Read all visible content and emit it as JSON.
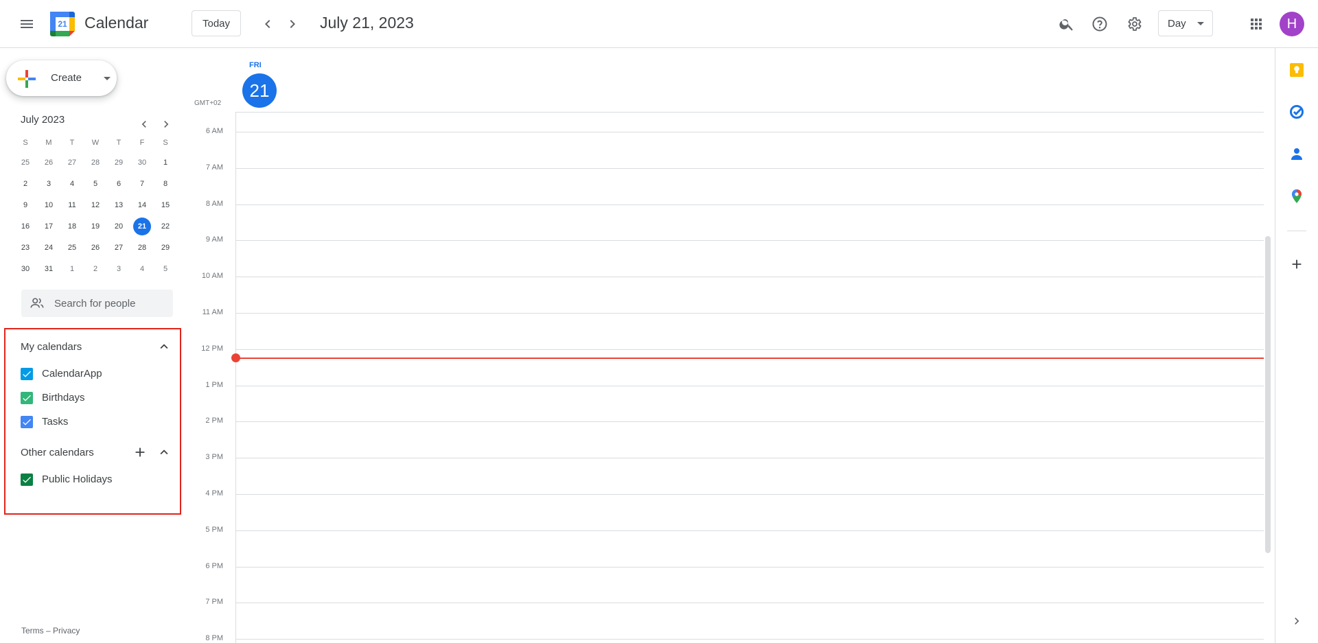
{
  "header": {
    "app_title": "Calendar",
    "logo_day": "21",
    "today_label": "Today",
    "date_title": "July 21, 2023",
    "view_label": "Day",
    "avatar_initial": "H",
    "icons": [
      "menu-icon",
      "chevron-left-icon",
      "chevron-right-icon",
      "search-icon",
      "help-icon",
      "settings-icon",
      "apps-icon"
    ]
  },
  "sidebar": {
    "create_label": "Create",
    "mini_calendar": {
      "month_title": "July 2023",
      "weekdays": [
        "S",
        "M",
        "T",
        "W",
        "T",
        "F",
        "S"
      ],
      "weeks": [
        [
          "25",
          "26",
          "27",
          "28",
          "29",
          "30",
          "1"
        ],
        [
          "2",
          "3",
          "4",
          "5",
          "6",
          "7",
          "8"
        ],
        [
          "9",
          "10",
          "11",
          "12",
          "13",
          "14",
          "15"
        ],
        [
          "16",
          "17",
          "18",
          "19",
          "20",
          "21",
          "22"
        ],
        [
          "23",
          "24",
          "25",
          "26",
          "27",
          "28",
          "29"
        ],
        [
          "30",
          "31",
          "1",
          "2",
          "3",
          "4",
          "5"
        ]
      ],
      "selected": "21"
    },
    "people_search_placeholder": "Search for people",
    "my_calendars": {
      "title": "My calendars",
      "items": [
        {
          "label": "CalendarApp",
          "color": "#039be5"
        },
        {
          "label": "Birthdays",
          "color": "#33b679"
        },
        {
          "label": "Tasks",
          "color": "#4285f4"
        }
      ]
    },
    "other_calendars": {
      "title": "Other calendars",
      "items": [
        {
          "label": "Public Holidays",
          "color": "#0b8043"
        }
      ]
    },
    "footer": {
      "terms": "Terms",
      "separator": "–",
      "privacy": "Privacy"
    }
  },
  "day_view": {
    "weekday": "FRI",
    "day_number": "21",
    "timezone": "GMT+02",
    "hours": [
      "6 AM",
      "7 AM",
      "8 AM",
      "9 AM",
      "10 AM",
      "11 AM",
      "12 PM",
      "1 PM",
      "2 PM",
      "3 PM",
      "4 PM",
      "5 PM",
      "6 PM",
      "7 PM",
      "8 PM"
    ],
    "now_indicator_color": "#ea4335"
  },
  "right_rail": {
    "icons": [
      "keep-icon",
      "tasks-icon",
      "contacts-icon",
      "maps-icon",
      "add-icon",
      "chevron-right-icon"
    ]
  },
  "colors": {
    "accent": "#1a73e8",
    "highlight_border": "#e0241c"
  }
}
